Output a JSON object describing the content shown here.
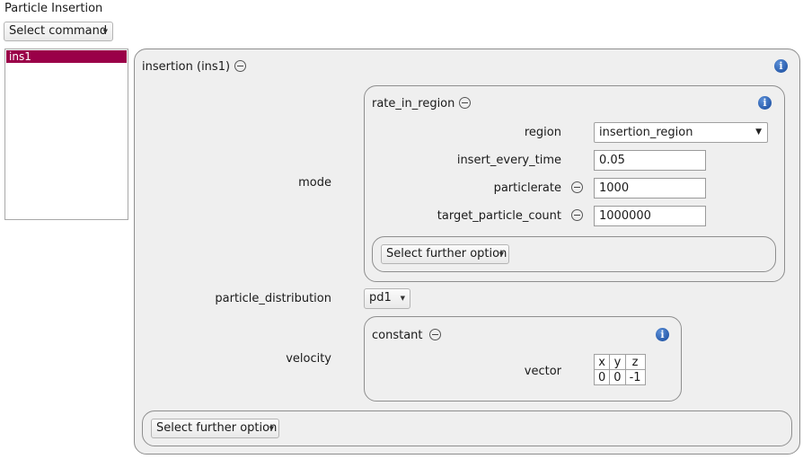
{
  "window": {
    "title": "Particle Insertion"
  },
  "command_select": {
    "label": "Select command"
  },
  "instances": {
    "items": [
      "ins1"
    ],
    "selected": "ins1"
  },
  "insertion": {
    "header": "insertion (ins1)",
    "mode_label": "mode",
    "mode": {
      "header": "rate_in_region",
      "region": {
        "label": "region",
        "value": "insertion_region"
      },
      "insert_every_time": {
        "label": "insert_every_time",
        "value": "0.05"
      },
      "particlerate": {
        "label": "particlerate",
        "value": "1000"
      },
      "target_particle_count": {
        "label": "target_particle_count",
        "value": "1000000"
      },
      "further_option": "Select further option"
    },
    "particle_distribution": {
      "label": "particle_distribution",
      "value": "pd1"
    },
    "velocity": {
      "label": "velocity",
      "header": "constant",
      "vector_label": "vector",
      "columns": [
        "x",
        "y",
        "z"
      ],
      "values": [
        "0",
        "0",
        "-1"
      ]
    },
    "further_option": "Select further option"
  },
  "icons": {
    "info": "info-icon",
    "remove": "minus-circle-icon",
    "dropdown": "chevron-down-icon"
  },
  "colors": {
    "selection": "#9a0048",
    "panel_bg": "#efefef",
    "info_blue": "#1f5fb8"
  }
}
